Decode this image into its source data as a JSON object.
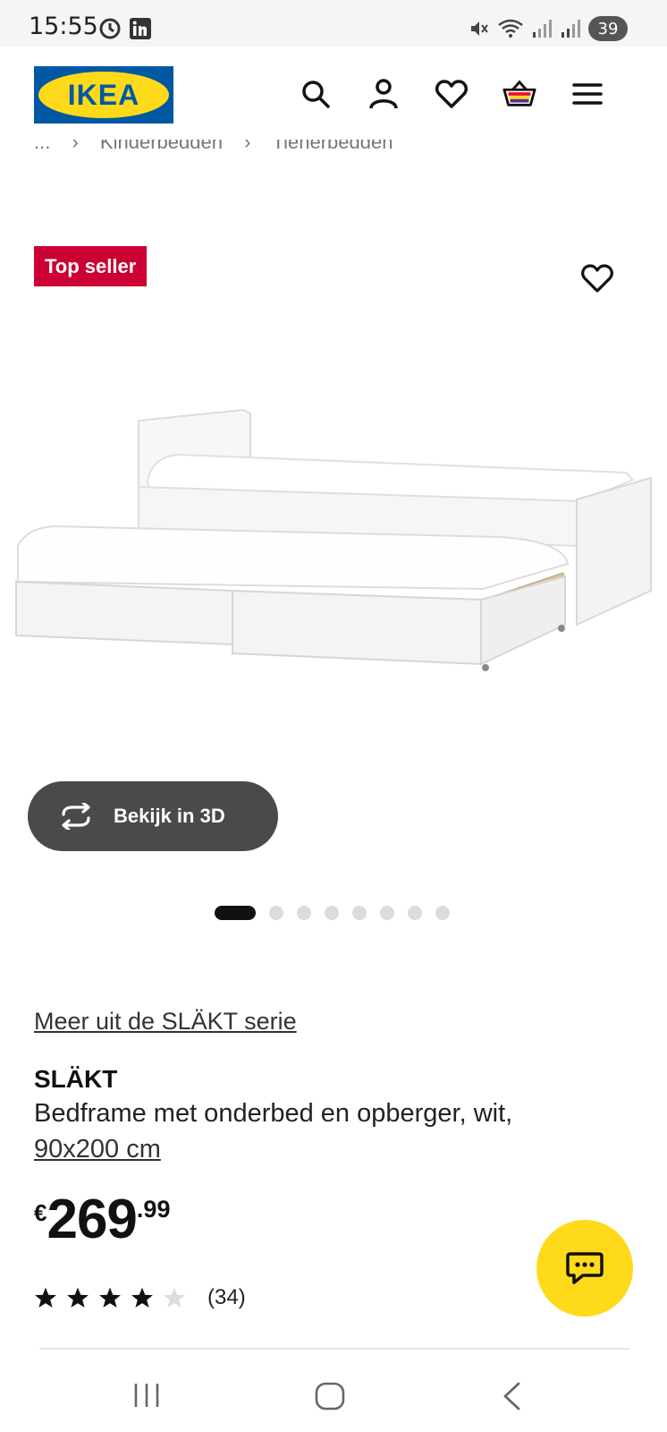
{
  "status_bar": {
    "time": "15:55",
    "battery": "39",
    "icons": [
      "sync-icon",
      "linkedin-icon",
      "mute-icon",
      "wifi-icon",
      "signal-icon",
      "signal-icon"
    ]
  },
  "header": {
    "logo_text": "IKEA",
    "icons": [
      "search-icon",
      "account-icon",
      "heart-icon",
      "basket-icon",
      "menu-icon"
    ]
  },
  "breadcrumb": [
    "...",
    "Kinderbedden",
    "Tienerbedden"
  ],
  "product": {
    "badge": "Top seller",
    "view_3d_label": "Bekijk in 3D",
    "carousel": {
      "total": 8,
      "active": 0
    },
    "series_link": "Meer uit de SLÄKT serie",
    "name": "SLÄKT",
    "description": "Bedframe met onderbed en opberger, wit,",
    "size_link": "90x200 cm",
    "price": {
      "currency": "€",
      "integer": "269",
      "decimal": ".99"
    },
    "rating": {
      "value": 4,
      "max": 5,
      "count_label": "(34)"
    }
  },
  "colors": {
    "ikea_blue": "#0058a3",
    "ikea_yellow": "#ffda1a",
    "badge_red": "#cc0033",
    "dark_button": "#4a4a4a"
  },
  "nav_bar": [
    "recents-button",
    "home-button",
    "back-button"
  ]
}
